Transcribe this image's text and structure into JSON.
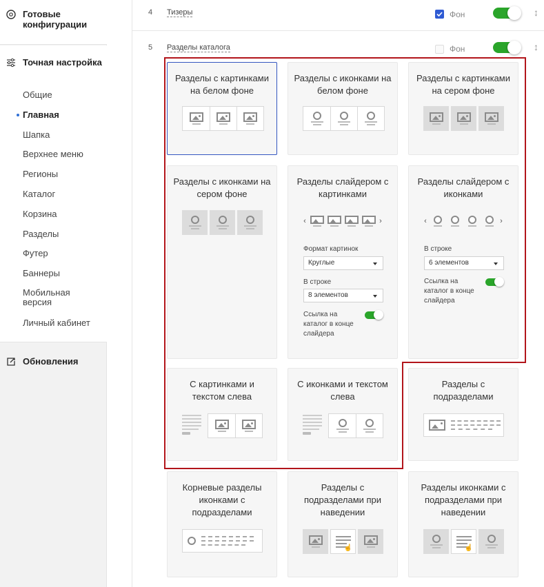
{
  "sidebar": {
    "ready_configs": "Готовые конфигурации",
    "fine_tuning": "Точная настройка",
    "items": [
      "Общие",
      "Главная",
      "Шапка",
      "Верхнее меню",
      "Регионы",
      "Каталог",
      "Корзина",
      "Разделы",
      "Футер",
      "Баннеры",
      "Мобильная версия",
      "Личный кабинет"
    ],
    "active_item": "Главная",
    "updates": "Обновления"
  },
  "rows": [
    {
      "num": "4",
      "name": "Тизеры",
      "bg_label": "Фон",
      "bg_checked": true,
      "enabled": true
    },
    {
      "num": "5",
      "name": "Разделы каталога",
      "bg_label": "Фон",
      "bg_checked": false,
      "enabled": true
    }
  ],
  "cards": {
    "c1": {
      "title": "Разделы с картинками на белом фоне"
    },
    "c2": {
      "title": "Разделы с иконками на белом фоне"
    },
    "c3": {
      "title": "Разделы с картинками на сером фоне"
    },
    "c4": {
      "title": "Разделы с иконками на сером фоне"
    },
    "c5": {
      "title": "Разделы слайдером с картинками",
      "format_label": "Формат картинок",
      "format_value": "Круглые",
      "row_label": "В строке",
      "row_value": "8 элементов",
      "link_label": "Ссылка на каталог в конце слайдера",
      "link_enabled": true
    },
    "c6": {
      "title": "Разделы слайдером с иконками",
      "row_label": "В строке",
      "row_value": "6 элементов",
      "link_label": "Ссылка на каталог в конце слайдера",
      "link_enabled": true
    },
    "c7": {
      "title": "С картинками и текстом слева"
    },
    "c8": {
      "title": "С иконками и текстом слева"
    },
    "c9": {
      "title": "Разделы с подразделами"
    },
    "c10": {
      "title": "Корневые разделы иконками с подразделами"
    },
    "c11": {
      "title": "Разделы с подразделами при наведении"
    },
    "c12": {
      "title": "Разделы иконками с подразделами при наведении"
    }
  },
  "selected_card": "c1",
  "colors": {
    "accent": "#2f5bd3",
    "toggle_on": "#2aa52a",
    "highlight_frame": "#b2141a",
    "selected_border": "#3355c0"
  },
  "icons": [
    "gear-circle-icon",
    "sliders-icon",
    "update-icon",
    "drag-handle-icon",
    "image-icon",
    "circle-icon",
    "pointer-hand-icon",
    "arrow-left-icon",
    "arrow-right-icon"
  ]
}
